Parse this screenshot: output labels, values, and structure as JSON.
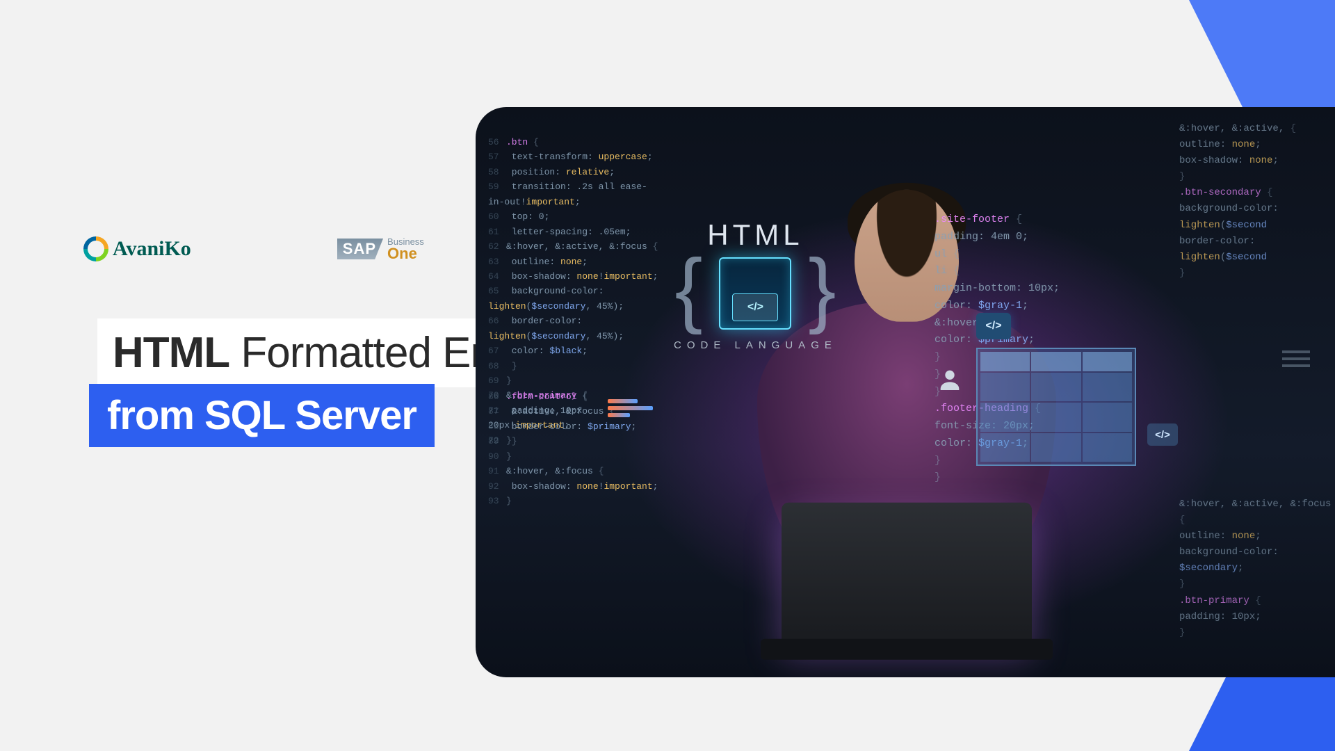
{
  "logos": {
    "avaniko": "AvaniKo",
    "sap_brand": "SAP",
    "sap_line1": "Business",
    "sap_line2": "One"
  },
  "headline": {
    "bold": "HTML",
    "rest": " Formatted Emails",
    "line2": "from SQL Server"
  },
  "html_block": {
    "title": "HTML",
    "icon_label": "</>",
    "subtitle": "CODE LANGUAGE"
  },
  "chips": {
    "angle1": "</>",
    "angle2": "</>"
  },
  "code_left": [
    ".btn {",
    "  text-transform: uppercase;",
    "  position: relative;",
    "  transition: .2s all ease-in-out!important;",
    "  top: 0;",
    "  letter-spacing: .05em;",
    "&:hover, &:active, &:focus {",
    "    outline: none;",
    "    box-shadow: none!important;",
    "    background-color: lighten($secondary, 45%);",
    "    border-color: lighten($secondary, 45%);",
    "    color: $black;",
    "  }",
    "}",
    "&.btn-primary {",
    "  padding: 10px 20px!important;",
    "}"
  ],
  "code_left2": [
    ".form-control {",
    "  &:active, &:focus {",
    "    border-color: $primary;",
    "  }",
    "}",
    "&:hover, &:focus {",
    "  box-shadow: none!important;",
    "}"
  ],
  "code_rightF": [
    ".site-footer {",
    "  padding: 4em 0;",
    "  ul {",
    "    li {",
    "      margin-bottom: 10px;",
    "      color: $gray-1;",
    "      &:hover {",
    "        color: $primary;",
    "      }",
    "    }",
    "  }",
    "  .footer-heading {",
    "    font-size: 20px;",
    "    color: $gray-1;",
    "  }",
    "}"
  ],
  "code_farR": [
    "&:hover, &:active, {",
    "  outline: none;",
    "  box-shadow: none;",
    "}",
    ".btn-secondary {",
    "  background-color: lighten($second",
    "  border-color: lighten($second",
    "}"
  ],
  "code_farR2": [
    "",
    "  &:hover, &:active, &:focus {",
    "    outline: none;",
    "    background-color: $secondary;",
    "  }",
    ".btn-primary {",
    "  padding: 10px;",
    "}"
  ]
}
